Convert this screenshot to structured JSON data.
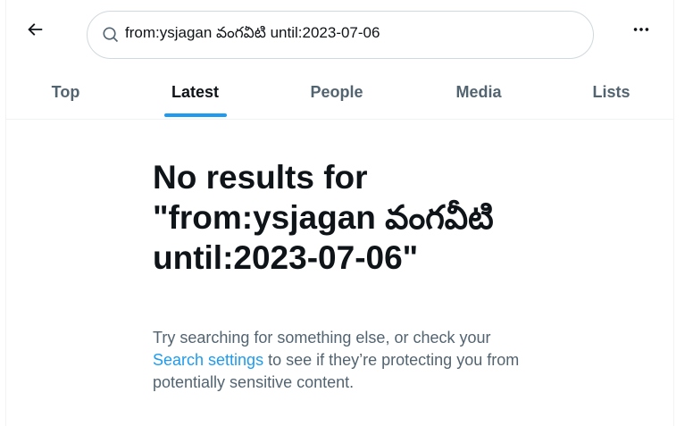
{
  "header": {
    "search_value": "from:ysjagan వంగవీటి until:2023-07-06"
  },
  "tabs": [
    {
      "label": "Top",
      "active": false
    },
    {
      "label": "Latest",
      "active": true
    },
    {
      "label": "People",
      "active": false
    },
    {
      "label": "Media",
      "active": false
    },
    {
      "label": "Lists",
      "active": false
    }
  ],
  "empty_state": {
    "title": "No results for \"from:ysjagan వంగవీటి until:2023-07-06\"",
    "sub_before": "Try searching for something else, or check your ",
    "link": "Search settings",
    "sub_after": " to see if they’re protecting you from potentially sensitive content."
  },
  "colors": {
    "accent": "#1d9bf0",
    "text": "#0f1419",
    "muted": "#536471",
    "border": "#cfd9de"
  },
  "icons": [
    "back-arrow-icon",
    "search-icon",
    "more-icon"
  ]
}
